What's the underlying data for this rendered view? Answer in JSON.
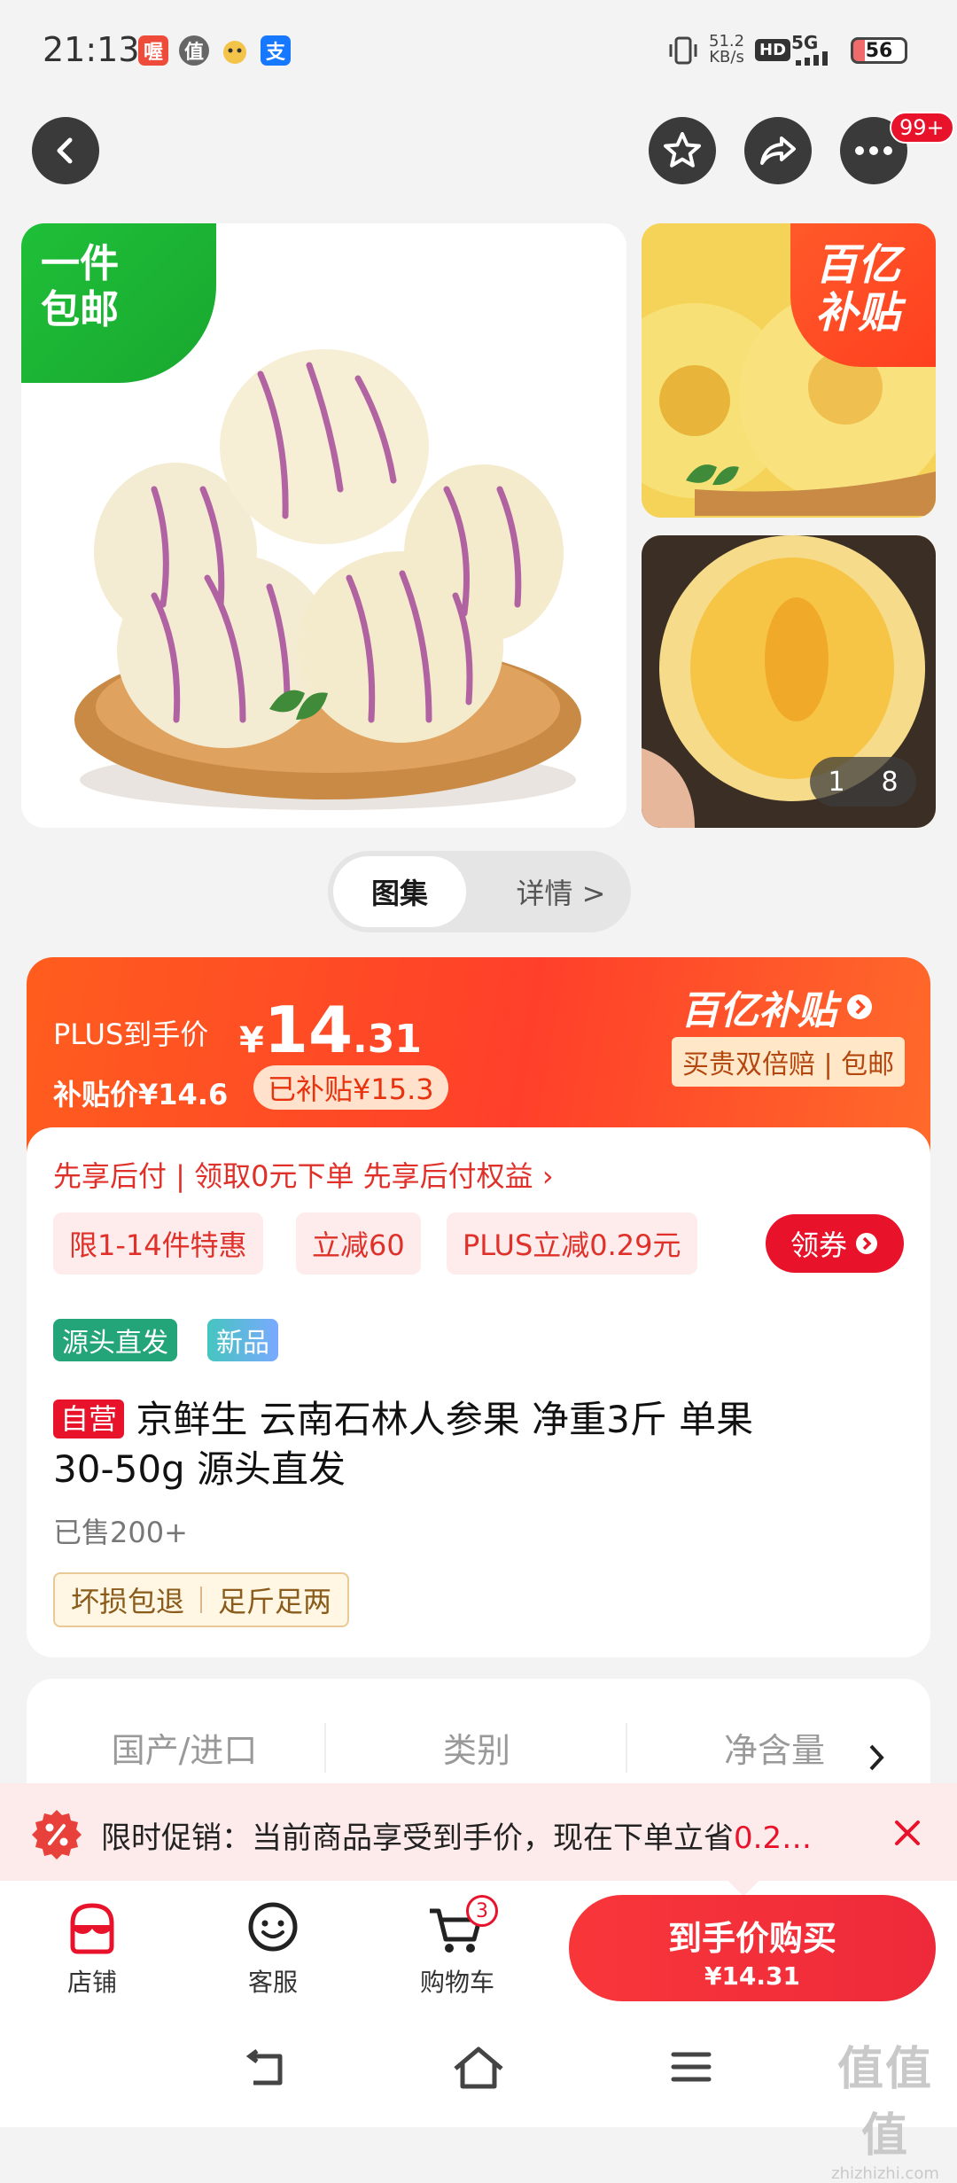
{
  "status_bar": {
    "time": "21:13",
    "apps": [
      "喔",
      "值",
      "支"
    ],
    "net_speed_value": "51.2",
    "net_speed_unit": "KB/s",
    "hd": "HD",
    "network": "5G",
    "battery": "56"
  },
  "header": {
    "more_badge": "99+"
  },
  "gallery": {
    "main_badge_line1": "一件",
    "main_badge_line2": "包邮",
    "thumb_badge_line1": "百亿",
    "thumb_badge_line2": "补贴",
    "counter_current": "1",
    "counter_total": "8",
    "tab_gallery": "图集",
    "tab_detail": "详情 >"
  },
  "price": {
    "plus_label": "PLUS到手价",
    "currency": "¥",
    "plus_int": "14",
    "plus_dec": ".31",
    "subsidy_label": "补贴价¥14.6",
    "subsidy_badge": "已补贴¥15.3",
    "brand_logo": "百亿补贴",
    "guarantee": "买贵双倍赔 | 包邮"
  },
  "info": {
    "pay_later": "先享后付 | 领取0元下单 先享后付权益 ›",
    "chips": [
      "限1-14件特惠",
      "立减60",
      "PLUS立减0.29元"
    ],
    "coupon_button": "领券",
    "tags": [
      "源头直发",
      "新品"
    ],
    "self_operated": "自营",
    "title_line1": "京鲜生 云南石林人参果 净重3斤 单果",
    "title_line2": "30-50g  源头直发",
    "sold": "已售200+",
    "services": [
      "坏损包退",
      "足斤足两"
    ]
  },
  "specs": {
    "items": [
      "国产/进口",
      "类别",
      "净含量"
    ]
  },
  "promo": {
    "text_before": "限时促销：当前商品享受到手价，现在下单立省",
    "text_highlight": "0.2…"
  },
  "bottom_bar": {
    "store": "店铺",
    "service": "客服",
    "cart": "购物车",
    "cart_badge": "3",
    "buy_label": "到手价购买",
    "buy_price": "¥14.31"
  },
  "watermark": {
    "logo": "值值值",
    "domain": "zhizhizhi.com"
  },
  "colors": {
    "accent_red": "#e8132b",
    "price_orange": "#ff4b23",
    "tag_green": "#23a579",
    "promo_bg": "#fdeaea"
  }
}
